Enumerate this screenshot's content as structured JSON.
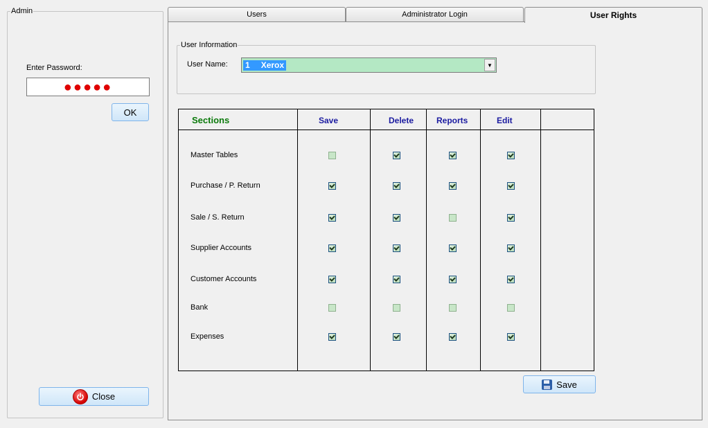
{
  "admin": {
    "group_title": "Admin",
    "password_label": "Enter Password:",
    "password_mask": "●●●●●",
    "ok_label": "OK",
    "close_label": "Close"
  },
  "tabs": [
    {
      "label": "Users",
      "active": false
    },
    {
      "label": "Administrator Login",
      "active": false
    },
    {
      "label": "User Rights",
      "active": true
    }
  ],
  "user_info": {
    "group_title": "User Information",
    "username_label": "User Name:",
    "selected_id": "1",
    "selected_name": "Xerox"
  },
  "grid": {
    "columns": [
      "Sections",
      "Save",
      "Delete",
      "Reports",
      "Edit"
    ],
    "rows": [
      {
        "label": "Master Tables",
        "save": false,
        "delete": true,
        "reports": true,
        "edit": true
      },
      {
        "label": "Purchase / P. Return",
        "save": true,
        "delete": true,
        "reports": true,
        "edit": true
      },
      {
        "label": "Sale / S. Return",
        "save": true,
        "delete": true,
        "reports": false,
        "edit": true
      },
      {
        "label": "Supplier Accounts",
        "save": true,
        "delete": true,
        "reports": true,
        "edit": true
      },
      {
        "label": "Customer Accounts",
        "save": true,
        "delete": true,
        "reports": true,
        "edit": true
      },
      {
        "label": "Bank",
        "save": false,
        "delete": false,
        "reports": false,
        "edit": false
      },
      {
        "label": "Expenses",
        "save": true,
        "delete": true,
        "reports": true,
        "edit": true
      }
    ]
  },
  "save_label": "Save",
  "colors": {
    "sections_header": "#0b7a0b",
    "column_header": "#1a1aa0",
    "combo_background": "#b4e8c4",
    "selection": "#3399ff",
    "password_dots": "#e00000"
  }
}
